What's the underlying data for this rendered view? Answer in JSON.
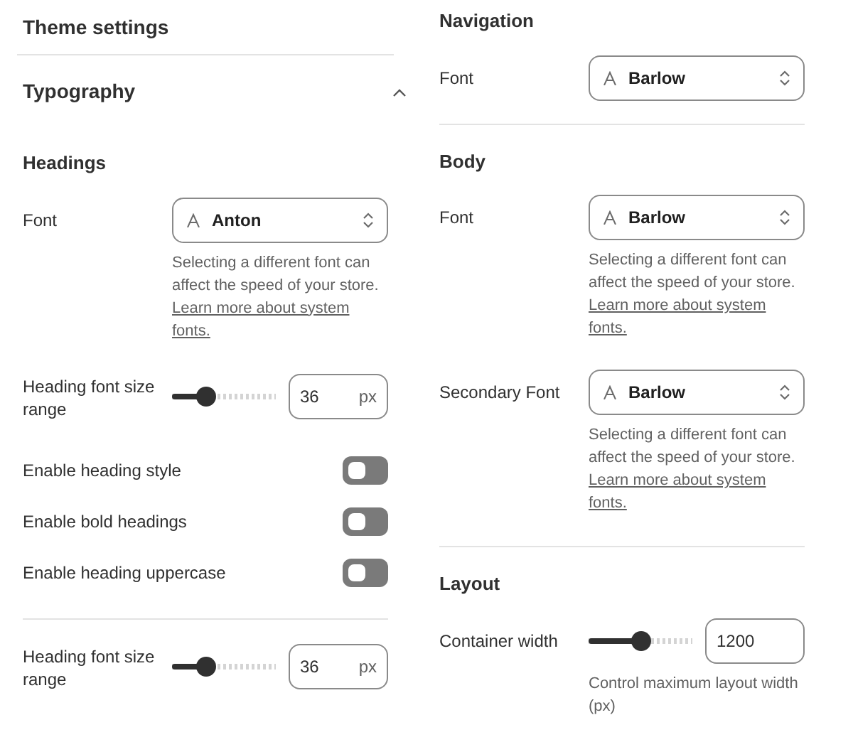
{
  "left": {
    "title": "Theme settings",
    "panel": {
      "title": "Typography",
      "expanded": true,
      "groups": [
        {
          "heading": "Headings",
          "rows": [
            {
              "kind": "select",
              "label": "Font",
              "value": "Anton",
              "help": "Selecting a different font can affect the speed of your store.",
              "link": "Learn more about system fonts."
            },
            {
              "kind": "slider",
              "label": "Heading font size range",
              "level": 0.33,
              "value": "36",
              "unit": "px"
            },
            {
              "kind": "toggle",
              "label": "Enable heading style",
              "on": false
            },
            {
              "kind": "toggle",
              "label": "Enable bold headings",
              "on": false
            },
            {
              "kind": "toggle",
              "label": "Enable heading uppercase",
              "on": false
            }
          ]
        },
        {
          "rows": [
            {
              "kind": "slider",
              "label": "Heading font size range",
              "level": 0.33,
              "value": "36",
              "unit": "px"
            }
          ]
        }
      ]
    }
  },
  "right": {
    "groups": [
      {
        "heading": "Navigation",
        "rows": [
          {
            "kind": "select",
            "label": "Font",
            "value": "Barlow"
          }
        ]
      },
      {
        "heading": "Body",
        "rows": [
          {
            "kind": "select",
            "label": "Font",
            "value": "Barlow",
            "help": "Selecting a different font can affect the speed of your store.",
            "link": "Learn more about system fonts."
          },
          {
            "kind": "select",
            "label": "Secondary Font",
            "value": "Barlow",
            "help": "Selecting a different font can affect the speed of your store.",
            "link": "Learn more about system fonts."
          }
        ]
      },
      {
        "heading": "Layout",
        "rows": [
          {
            "kind": "slider",
            "label": "Container width",
            "level": 0.5,
            "value": "1200",
            "help": "Control maximum layout width (px)"
          }
        ]
      }
    ]
  }
}
